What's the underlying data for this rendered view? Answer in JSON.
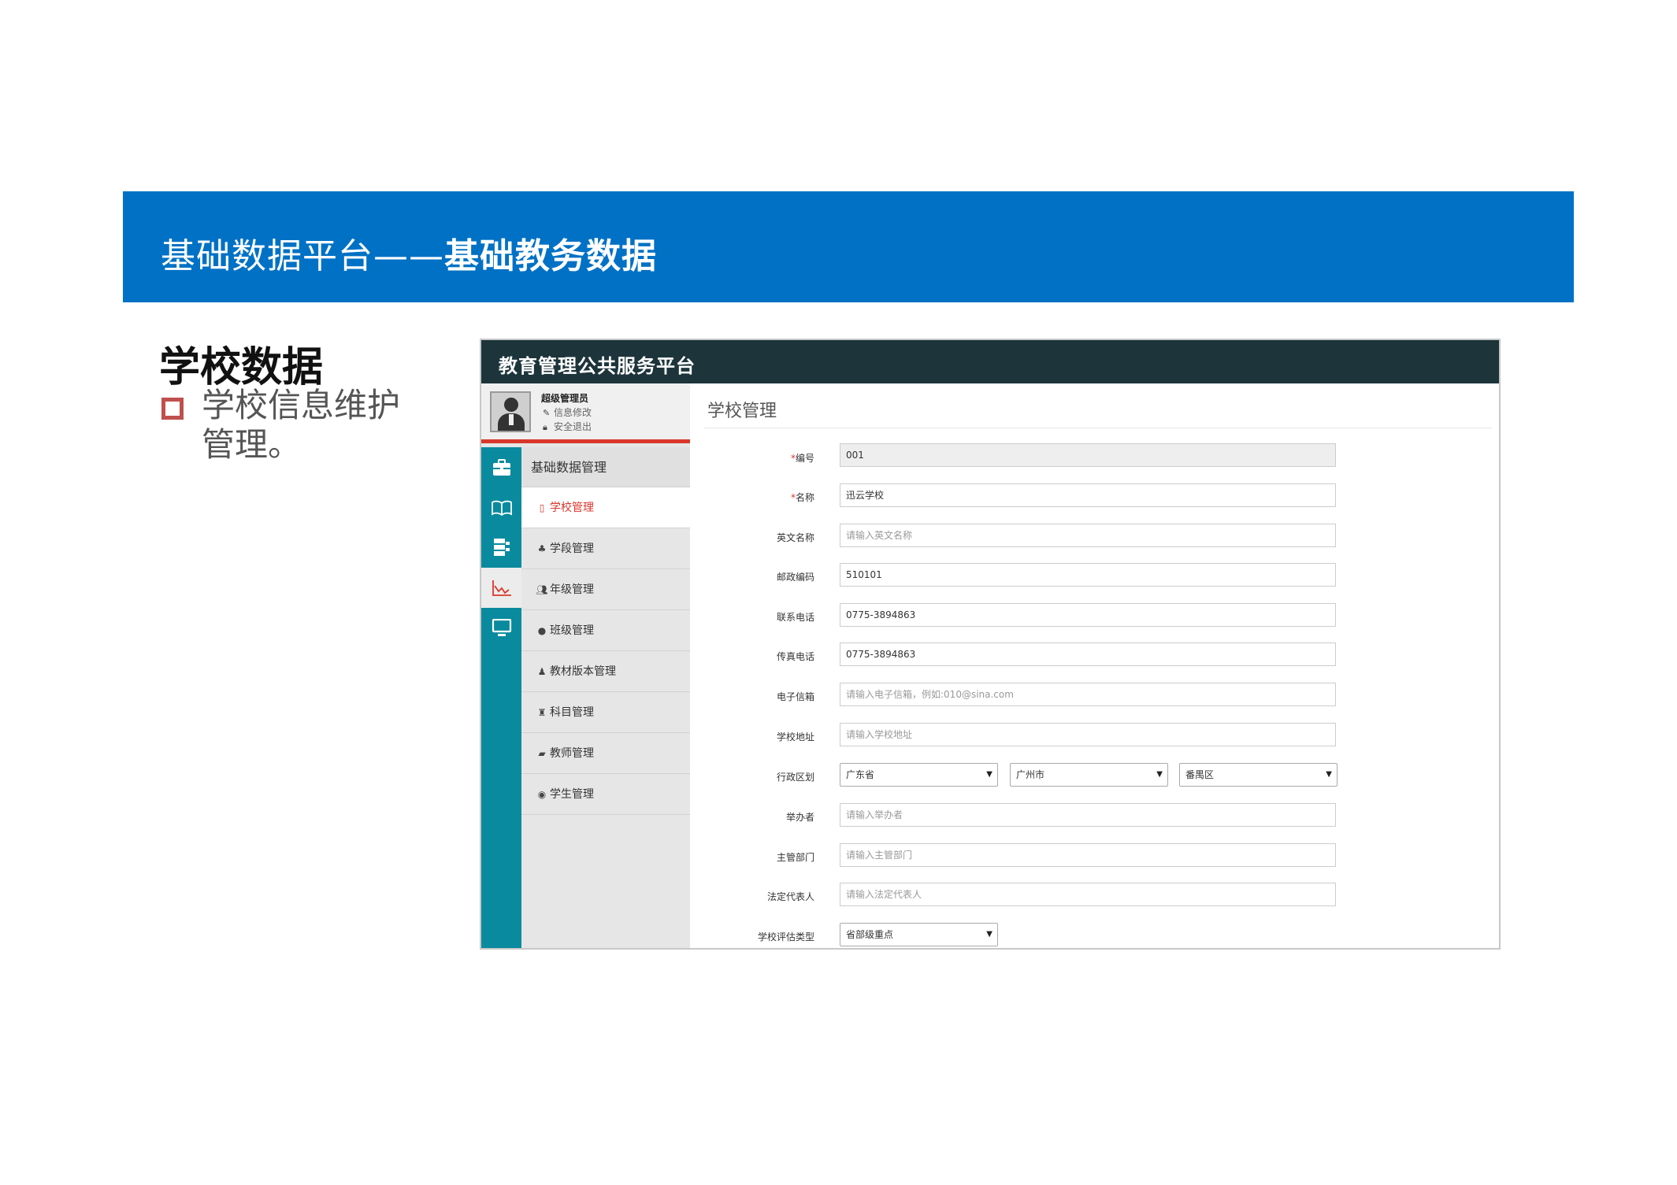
{
  "slide": {
    "banner_title_light": "基础数据平台——",
    "banner_title_bold": "基础教务数据",
    "heading": "学校数据",
    "bullet": "学校信息维护管理。",
    "banner_color": "#0071c5",
    "bullet_color": "#c0504d"
  },
  "app": {
    "title": "教育管理公共服务平台",
    "header_color": "#1d343b",
    "accent_color": "#d9372b",
    "rail_color": "#0a8a9e",
    "profile": {
      "name": "超级管理员",
      "edit_link": "信息修改",
      "logout_link": "安全退出",
      "edit_icon": "pencil-icon",
      "logout_icon": "lock-icon"
    },
    "rail_icons": [
      "briefcase-icon",
      "book-icon",
      "database-icon",
      "chart-icon",
      "monitor-icon"
    ],
    "menu_header": "基础数据管理",
    "menu": [
      {
        "label": "学校管理",
        "icon": "tablet-icon",
        "active": true
      },
      {
        "label": "学段管理",
        "icon": "sitemap-icon",
        "active": false
      },
      {
        "label": "年级管理",
        "icon": "users-icon",
        "active": false
      },
      {
        "label": "班级管理",
        "icon": "user-icon",
        "active": false
      },
      {
        "label": "教材版本管理",
        "icon": "user-tie-icon",
        "active": false
      },
      {
        "label": "科目管理",
        "icon": "trophy-icon",
        "active": false
      },
      {
        "label": "教师管理",
        "icon": "book-icon",
        "active": false
      },
      {
        "label": "学生管理",
        "icon": "eye-icon",
        "active": false
      }
    ],
    "main": {
      "title": "学校管理",
      "fields": {
        "code": {
          "label": "编号",
          "value": "001"
        },
        "name": {
          "label": "名称",
          "value": "迅云学校"
        },
        "english_name": {
          "label": "英文名称",
          "placeholder": "请输入英文名称"
        },
        "postcode": {
          "label": "邮政编码",
          "value": "510101"
        },
        "phone": {
          "label": "联系电话",
          "value": "0775-3894863"
        },
        "fax": {
          "label": "传真电话",
          "value": "0775-3894863"
        },
        "email": {
          "label": "电子信箱",
          "placeholder": "请输入电子信箱，例如:010@sina.com"
        },
        "address": {
          "label": "学校地址",
          "placeholder": "请输入学校地址"
        },
        "region": {
          "label": "行政区划",
          "province": "广东省",
          "city": "广州市",
          "district": "番禺区"
        },
        "organizer": {
          "label": "举办者",
          "placeholder": "请输入举办者"
        },
        "department": {
          "label": "主管部门",
          "placeholder": "请输入主管部门"
        },
        "legal_rep": {
          "label": "法定代表人",
          "placeholder": "请输入法定代表人"
        },
        "eval_type": {
          "label": "学校评估类型",
          "value": "省部级重点"
        }
      }
    }
  }
}
